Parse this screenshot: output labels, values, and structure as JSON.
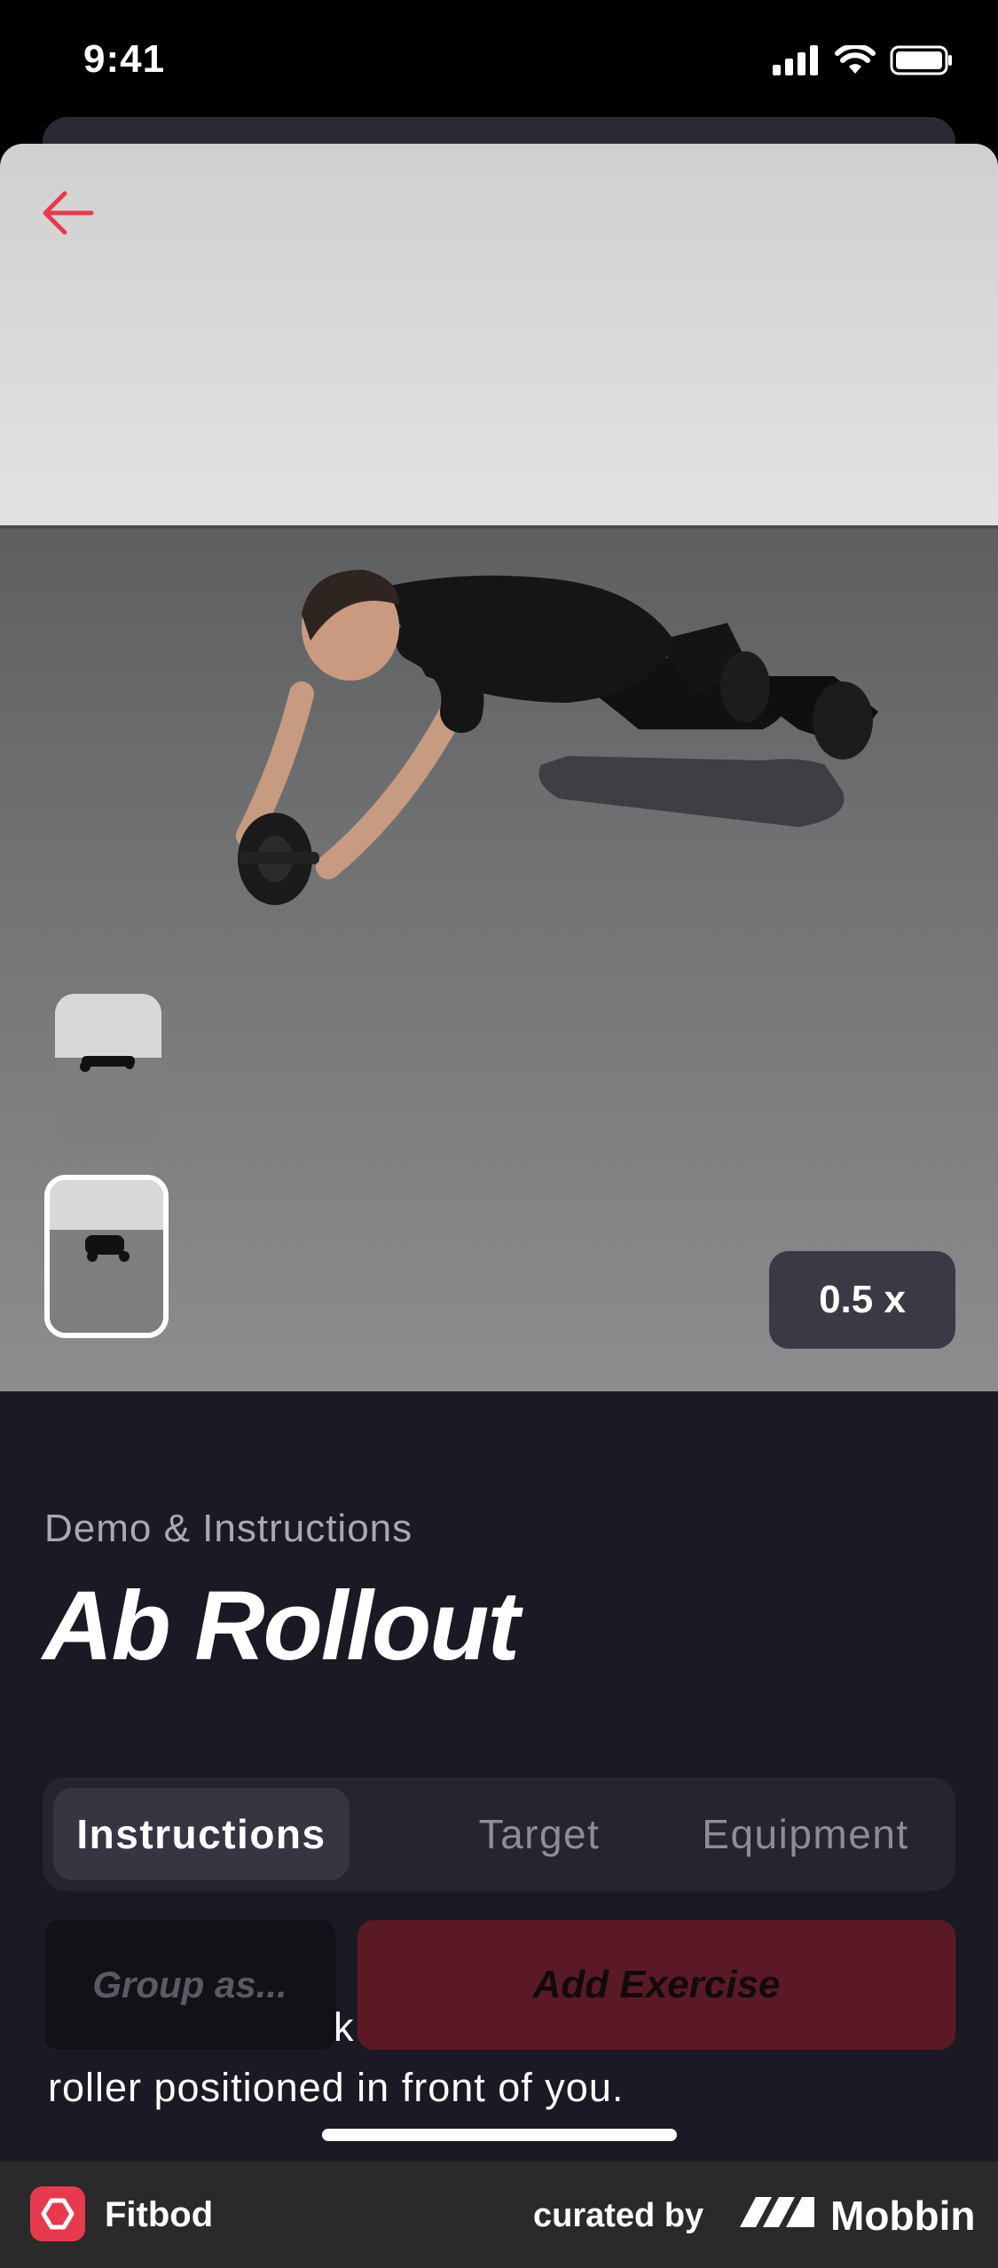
{
  "status_bar": {
    "time": "9:41",
    "icons": [
      "cellular-signal-icon",
      "wifi-icon",
      "battery-icon"
    ]
  },
  "video": {
    "speed_label": "0.5 x",
    "thumbnails_count": 2,
    "selected_thumbnail": 2
  },
  "header": {
    "subtitle": "Demo & Instructions",
    "title": "Ab Rollout"
  },
  "tabs": [
    {
      "label": "Instructions",
      "active": true
    },
    {
      "label": "Target",
      "active": false
    },
    {
      "label": "Equipment",
      "active": false
    }
  ],
  "instructions": {
    "line1_visible": "k",
    "line2": "roller positioned in front of you."
  },
  "actions": {
    "group_label": "Group as...",
    "add_label": "Add Exercise"
  },
  "footer": {
    "app_name": "Fitbod",
    "curated_by": "curated by",
    "brand": "Mobbin"
  },
  "colors": {
    "accent": "#e83a4f",
    "background": "#1b1a24",
    "add_button": "#5a1a25"
  }
}
